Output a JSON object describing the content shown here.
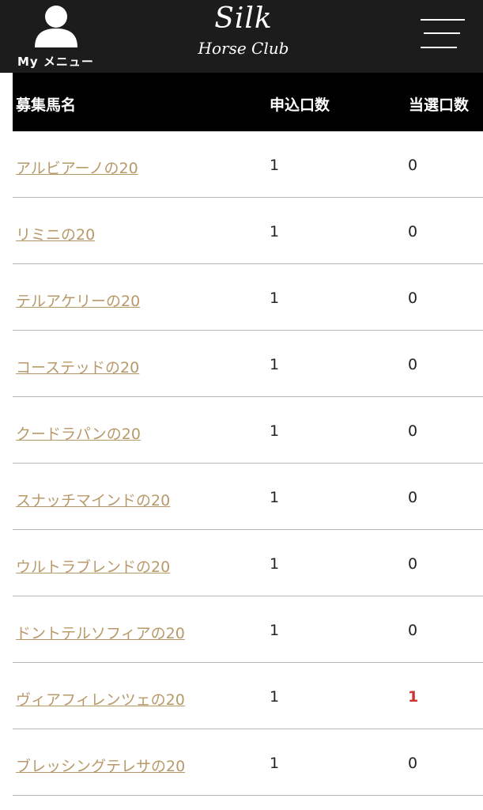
{
  "header": {
    "my_menu_label": "My メニュー",
    "logo_top": "Silk",
    "logo_bottom": "Horse Club"
  },
  "table": {
    "columns": [
      "募集馬名",
      "申込口数",
      "当選口数"
    ],
    "rows": [
      {
        "name": "アルビアーノの20",
        "applied": "1",
        "won": "0"
      },
      {
        "name": "リミニの20",
        "applied": "1",
        "won": "0"
      },
      {
        "name": "テルアケリーの20",
        "applied": "1",
        "won": "0"
      },
      {
        "name": "コーステッドの20",
        "applied": "1",
        "won": "0"
      },
      {
        "name": "クードラパンの20",
        "applied": "1",
        "won": "0"
      },
      {
        "name": "スナッチマインドの20",
        "applied": "1",
        "won": "0"
      },
      {
        "name": "ウルトラブレンドの20",
        "applied": "1",
        "won": "0"
      },
      {
        "name": "ドントテルソフィアの20",
        "applied": "1",
        "won": "0"
      },
      {
        "name": "ヴィアフィレンツェの20",
        "applied": "1",
        "won": "1"
      },
      {
        "name": "ブレッシングテレサの20",
        "applied": "1",
        "won": "0"
      }
    ]
  },
  "colors": {
    "header_bg": "#1c1c1c",
    "table_head_bg": "#000000",
    "link": "#b89a6a",
    "won_highlight": "#d0312d"
  }
}
